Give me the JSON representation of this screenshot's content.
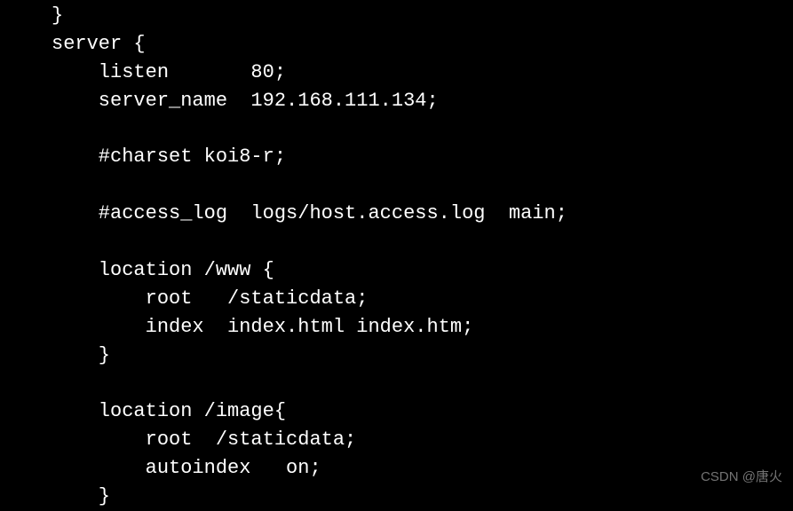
{
  "code": {
    "lines": [
      "}",
      "server {",
      "    listen       80;",
      "    server_name  192.168.111.134;",
      "",
      "    #charset koi8-r;",
      "",
      "    #access_log  logs/host.access.log  main;",
      "",
      "    location /www {",
      "        root   /staticdata;",
      "        index  index.html index.htm;",
      "    }",
      "",
      "    location /image{",
      "        root  /staticdata;",
      "        autoindex   on;",
      "    }"
    ]
  },
  "watermark": "CSDN @唐火"
}
